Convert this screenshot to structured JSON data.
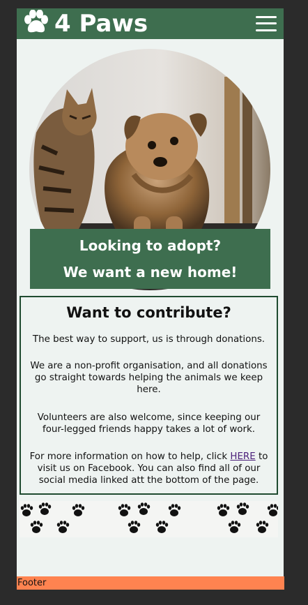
{
  "brand": {
    "logo_icon": "paw-icon",
    "name": "4 Paws"
  },
  "nav": {
    "menu_icon": "hamburger-menu-icon"
  },
  "hero": {
    "image": "cat-and-dog-photo",
    "line1": "Looking to adopt?",
    "line2": "We want a new home!"
  },
  "contribute": {
    "title": "Want to contribute?",
    "p1": "The best way to support, us is through donations.",
    "p2": "We are a non-profit organisation, and all donations go straight towards helping the animals we keep here.",
    "p3": "Volunteers are also welcome, since keeping our four-legged friends happy takes a lot of work.",
    "p4_before": "For more information on how to help, click ",
    "p4_link": "HERE",
    "p4_after": " to visit us on Facebook. You can also find all of our social media linked att the bottom of the page."
  },
  "decor": {
    "pattern_icon": "paw-prints-pattern"
  },
  "footer": {
    "text": "Footer"
  },
  "colors": {
    "background": "#2b2b2b",
    "page": "#eef3f1",
    "primary_green": "#3e6e4f",
    "border_green": "#1f4b30",
    "footer": "#ff8350",
    "link": "#4b1f7a"
  }
}
